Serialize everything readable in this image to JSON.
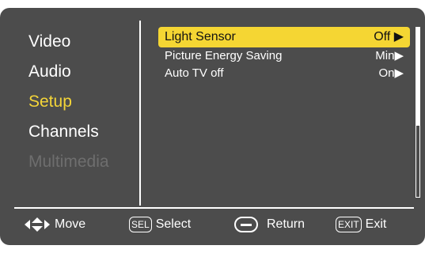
{
  "menu": {
    "items": [
      {
        "label": "Video"
      },
      {
        "label": "Audio"
      },
      {
        "label": "Setup",
        "active": true
      },
      {
        "label": "Channels"
      },
      {
        "label": "Multimedia",
        "disabled": true
      }
    ]
  },
  "setup": {
    "rows": [
      {
        "label": "Light Sensor",
        "value": "Off ▶"
      },
      {
        "label": "Picture Energy Saving",
        "value": "Min▶"
      },
      {
        "label": "Auto TV off",
        "value": "On▶"
      }
    ]
  },
  "footer": {
    "move": {
      "label": "Move",
      "icon": "four-way-arrow-icon"
    },
    "select": {
      "key": "SEL",
      "label": "Select"
    },
    "return": {
      "label": "Return",
      "icon": "return-icon"
    },
    "exit": {
      "key": "EXIT",
      "label": "Exit"
    }
  },
  "colors": {
    "background": "#4c4c4c",
    "active_text": "#f4d538",
    "highlight": "#f5d633",
    "disabled_text": "#6e6e6e"
  }
}
